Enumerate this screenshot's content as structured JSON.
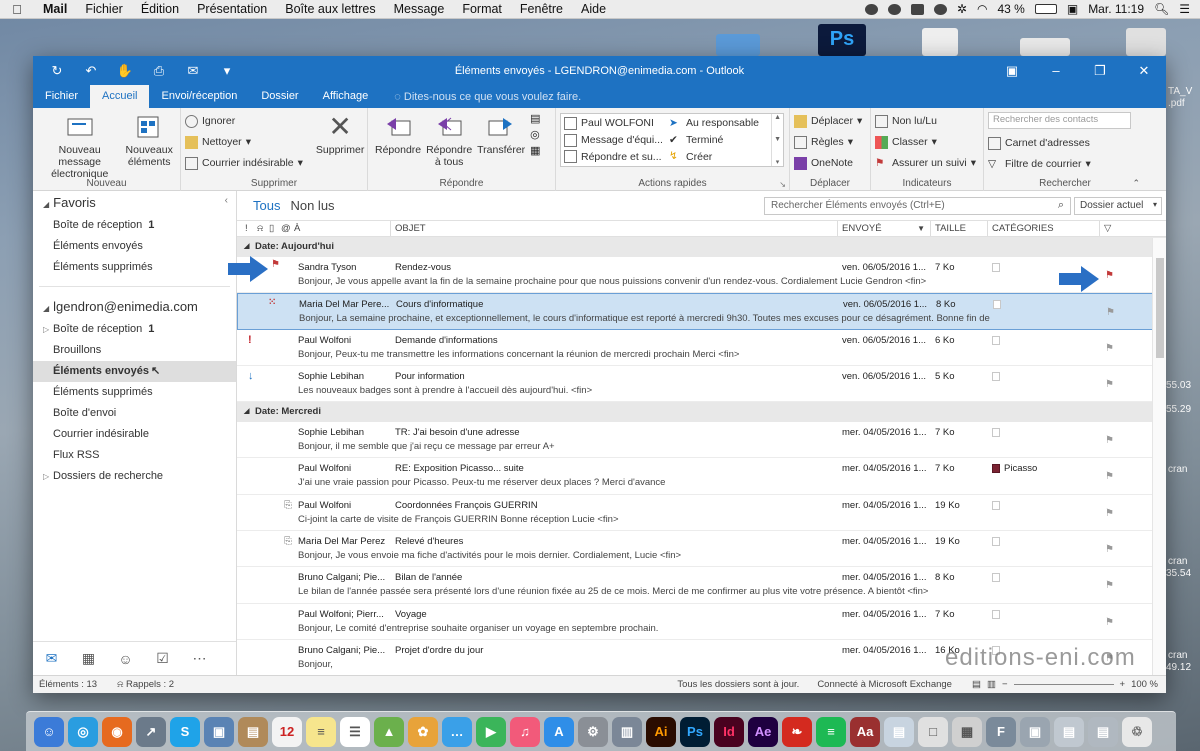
{
  "menubar": {
    "apple": "",
    "app": "Mail",
    "items": [
      "Fichier",
      "Édition",
      "Présentation",
      "Boîte aux lettres",
      "Message",
      "Format",
      "Fenêtre",
      "Aide"
    ],
    "battery": "43 %",
    "clock": "Mar. 11:19"
  },
  "window": {
    "title": "Éléments envoyés - LGENDRON@enimedia.com - Outlook"
  },
  "tabs": [
    "Fichier",
    "Accueil",
    "Envoi/réception",
    "Dossier",
    "Affichage"
  ],
  "tellme": "Dites-nous ce que vous voulez faire.",
  "ribbon": {
    "nouveau": {
      "label": "Nouveau",
      "new_message": "Nouveau message électronique",
      "new_items": "Nouveaux éléments"
    },
    "supprimer": {
      "label": "Supprimer",
      "ignore": "Ignorer",
      "clean": "Nettoyer",
      "junk": "Courrier indésirable",
      "delete": "Supprimer"
    },
    "repondre": {
      "label": "Répondre",
      "reply": "Répondre",
      "reply_all": "Répondre à tous",
      "forward": "Transférer"
    },
    "actions": {
      "label": "Actions rapides",
      "q1": "Paul WOLFONI",
      "q2": "Message d'équi...",
      "q3": "Répondre et su...",
      "q4": "Au responsable",
      "q5": "Terminé",
      "q6": "Créer"
    },
    "deplacer": {
      "label": "Déplacer",
      "move": "Déplacer",
      "rules": "Règles",
      "onenote": "OneNote"
    },
    "indicateurs": {
      "label": "Indicateurs",
      "unread": "Non lu/Lu",
      "classify": "Classer",
      "followup": "Assurer un suivi"
    },
    "rechercher": {
      "label": "Rechercher",
      "placeholder": "Rechercher des contacts",
      "addressbook": "Carnet d'adresses",
      "filter": "Filtre de courrier"
    }
  },
  "nav": {
    "favoris": "Favoris",
    "fav_items": [
      {
        "label": "Boîte de réception",
        "count": "1"
      },
      {
        "label": "Éléments envoyés",
        "count": ""
      },
      {
        "label": "Éléments supprimés",
        "count": ""
      }
    ],
    "account": "lgendron@enimedia.com",
    "acc_items": [
      {
        "label": "Boîte de réception",
        "count": "1"
      },
      {
        "label": "Brouillons",
        "count": ""
      },
      {
        "label": "Éléments envoyés",
        "count": ""
      },
      {
        "label": "Éléments supprimés",
        "count": ""
      },
      {
        "label": "Boîte d'envoi",
        "count": ""
      },
      {
        "label": "Courrier indésirable",
        "count": ""
      },
      {
        "label": "Flux RSS",
        "count": ""
      },
      {
        "label": "Dossiers de recherche",
        "count": ""
      }
    ]
  },
  "list": {
    "filter_all": "Tous",
    "filter_unread": "Non lus",
    "search_placeholder": "Rechercher Éléments envoyés (Ctrl+E)",
    "scope": "Dossier actuel",
    "columns": {
      "to": "À",
      "subject": "OBJET",
      "sent": "ENVOYÉ",
      "size": "TAILLE",
      "categories": "CATÉGORIES"
    },
    "groups": [
      {
        "label": "Date: Aujourd'hui",
        "mails": [
          {
            "from": "Sandra Tyson",
            "subject": "Rendez-vous",
            "preview": "Bonjour,  Je vous appelle avant la fin de la semaine prochaine pour que nous puissions convenir d'un rendez-vous.  Cordialement  Lucie Gendron <fin>",
            "sent": "ven. 06/05/2016 1...",
            "size": "7 Ko",
            "category": ""
          },
          {
            "from": "Maria Del Mar Pere...",
            "subject": "Cours d'informatique",
            "preview": "Bonjour,  La semaine prochaine, et exceptionnellement, le cours d'informatique est reporté à mercredi 9h30.  Toutes mes excuses pour ce désagrément.  Bonne fin de",
            "sent": "ven. 06/05/2016 1...",
            "size": "8 Ko",
            "category": ""
          },
          {
            "from": "Paul Wolfoni",
            "subject": "Demande d'informations",
            "preview": "Bonjour,  Peux-tu me transmettre les informations concernant la réunion de mercredi prochain  Merci <fin>",
            "sent": "ven. 06/05/2016 1...",
            "size": "6 Ko",
            "category": ""
          },
          {
            "from": "Sophie Lebihan",
            "subject": "Pour information",
            "preview": "Les nouveaux badges sont à prendre à l'accueil dès aujourd'hui. <fin>",
            "sent": "ven. 06/05/2016 1...",
            "size": "5 Ko",
            "category": ""
          }
        ]
      },
      {
        "label": "Date: Mercredi",
        "mails": [
          {
            "from": "Sophie Lebihan",
            "subject": "TR: J'ai besoin d'une adresse",
            "preview": "Bonjour, il me semble que j'ai reçu ce message par erreur  A+",
            "sent": "mer. 04/05/2016 1...",
            "size": "7 Ko",
            "category": ""
          },
          {
            "from": "Paul Wolfoni",
            "subject": "RE: Exposition Picasso... suite",
            "preview": "J'ai une vraie passion pour Picasso. Peux-tu me réserver deux places ?  Merci d'avance",
            "sent": "mer. 04/05/2016 1...",
            "size": "7 Ko",
            "category": "Picasso"
          },
          {
            "from": "Paul Wolfoni",
            "subject": "Coordonnées François GUERRIN",
            "preview": "Ci-joint la carte de visite de François GUERRIN  Bonne réception  Lucie <fin>",
            "sent": "mer. 04/05/2016 1...",
            "size": "19 Ko",
            "category": ""
          },
          {
            "from": "Maria Del Mar Perez",
            "subject": "Relevé d'heures",
            "preview": "Bonjour,  Je vous envoie ma fiche d'activités pour le mois dernier.  Cordialement,  Lucie <fin>",
            "sent": "mer. 04/05/2016 1...",
            "size": "19 Ko",
            "category": ""
          },
          {
            "from": "Bruno Calgani; Pie...",
            "subject": "Bilan de l'année",
            "preview": "Le bilan de l'année passée sera présenté lors d'une réunion fixée au 25 de ce mois.  Merci de me confirmer au plus vite votre présence.  A bientôt <fin>",
            "sent": "mer. 04/05/2016 1...",
            "size": "8 Ko",
            "category": ""
          },
          {
            "from": "Paul Wolfoni; Pierr...",
            "subject": "Voyage",
            "preview": "Bonjour,  Le comité d'entreprise souhaite organiser un voyage en septembre prochain.",
            "sent": "mer. 04/05/2016 1...",
            "size": "7 Ko",
            "category": ""
          },
          {
            "from": "Bruno Calgani; Pie...",
            "subject": "Projet d'ordre du jour",
            "preview": "Bonjour,",
            "sent": "mer. 04/05/2016 1...",
            "size": "16 Ko",
            "category": ""
          }
        ]
      }
    ]
  },
  "status": {
    "items": "Éléments : 13",
    "reminders": "Rappels : 2",
    "updated": "Tous les dossiers sont à jour.",
    "connection": "Connecté à Microsoft Exchange",
    "zoom": "100 %"
  },
  "desktop": {
    "labels": [
      "TA_V",
      ".pdf",
      "55.03",
      "55.29",
      "cran",
      "cran",
      "35.54",
      "cran",
      "49.12"
    ]
  },
  "watermark": "editions-eni.com",
  "colors": {
    "accent": "#1e72c2",
    "selection": "#cde1f3",
    "category_picasso": "#7b2332",
    "importance_high": "#c2262e"
  }
}
